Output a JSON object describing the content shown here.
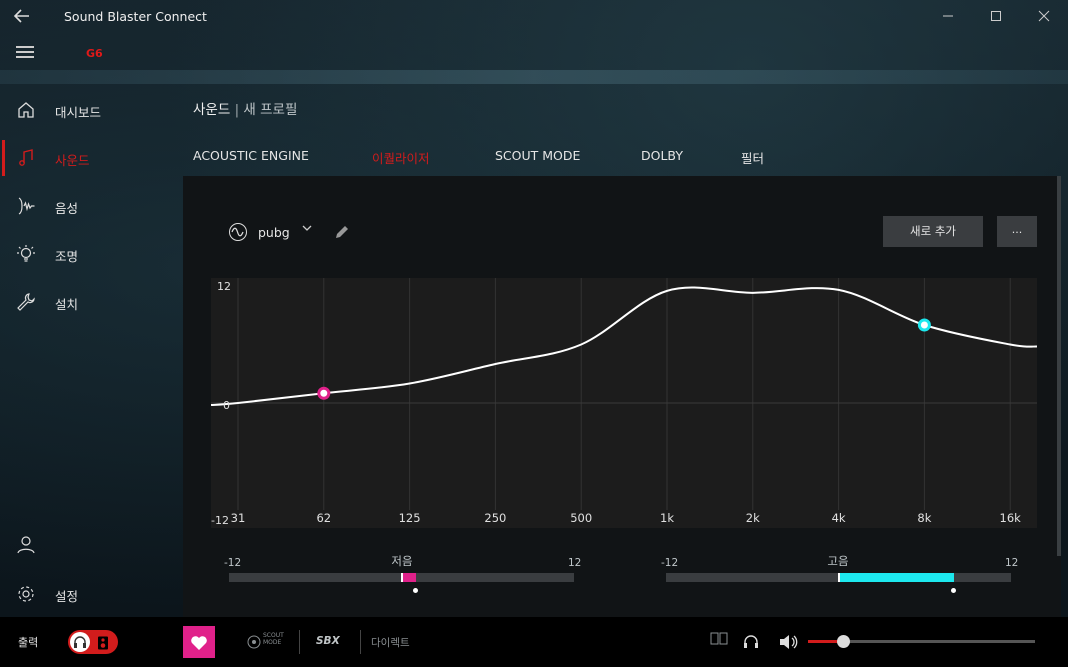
{
  "app": {
    "title": "Sound Blaster Connect",
    "device": "G6"
  },
  "icons": [
    "back-arrow-icon",
    "minimize-icon",
    "maximize-icon",
    "close-icon",
    "hamburger-icon",
    "home-icon",
    "music-note-icon",
    "voice-icon",
    "bulb-icon",
    "wrench-icon",
    "user-icon",
    "gear-icon",
    "waveform-icon",
    "pencil-icon",
    "headphones-icon",
    "speaker-icon",
    "heart-icon",
    "volume-icon",
    "dolby-audio-icon"
  ],
  "sidebar": {
    "items": [
      {
        "label": "대시보드",
        "icon": "home-icon",
        "active": false
      },
      {
        "label": "사운드",
        "icon": "music-note-icon",
        "active": true
      },
      {
        "label": "음성",
        "icon": "voice-icon",
        "active": false
      },
      {
        "label": "조명",
        "icon": "bulb-icon",
        "active": false
      },
      {
        "label": "설치",
        "icon": "wrench-icon",
        "active": false
      }
    ],
    "settings_label": "설정"
  },
  "breadcrumb": {
    "section": "사운드",
    "separator": "|",
    "profile": "새 프로필"
  },
  "tabs": [
    {
      "label": "ACOUSTIC ENGINE",
      "active": false
    },
    {
      "label": "이퀄라이저",
      "active": true
    },
    {
      "label": "SCOUT MODE",
      "active": false
    },
    {
      "label": "DOLBY",
      "active": false
    },
    {
      "label": "필터",
      "active": false
    }
  ],
  "preset": {
    "name": "pubg"
  },
  "buttons": {
    "add_new": "새로 추가",
    "more": "..."
  },
  "colors": {
    "accent_red": "#d21c1c",
    "bass_magenta": "#e0218a",
    "treble_cyan": "#1de8ee"
  },
  "chart_data": {
    "type": "line",
    "x": [
      "31",
      "62",
      "125",
      "250",
      "500",
      "1k",
      "2k",
      "4k",
      "8k",
      "16k"
    ],
    "y_ticks": [
      "12",
      "0",
      "-12"
    ],
    "ylim": [
      -12,
      12
    ],
    "values": [
      0,
      1,
      2,
      4,
      6,
      11.5,
      11.3,
      11.6,
      8,
      6
    ],
    "handles": [
      {
        "band": "62",
        "value": 1,
        "color": "#e0218a"
      },
      {
        "band": "8k",
        "value": 8,
        "color": "#1de8ee"
      }
    ],
    "grid": true
  },
  "bass": {
    "title": "저음",
    "min": "-12",
    "max": "12",
    "value": 1
  },
  "treble": {
    "title": "고음",
    "min": "-12",
    "max": "12",
    "value": 8
  },
  "bottom": {
    "output_label": "출력",
    "scout_mode": "SCOUT MODE",
    "sbx": "SBX",
    "direct": "다이렉트",
    "volume": 0.15
  }
}
